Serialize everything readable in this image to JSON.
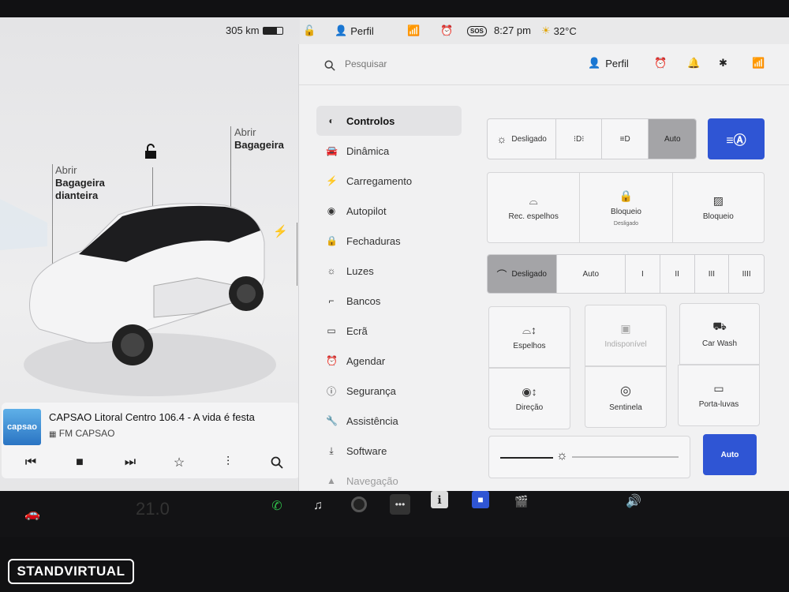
{
  "status": {
    "range": "305 km",
    "profile": "Perfil",
    "time": "8:27 pm",
    "temperature": "32°C",
    "sos": "SOS"
  },
  "car": {
    "front_trunk_action": "Abrir",
    "front_trunk_name_1": "Bagageira",
    "front_trunk_name_2": "dianteira",
    "rear_trunk_action": "Abrir",
    "rear_trunk_name": "Bagageira"
  },
  "media": {
    "art_text": "capsao",
    "title": "CAPSAO Litoral Centro 106.4 - A vida é festa",
    "source": "FM CAPSAO"
  },
  "search": {
    "placeholder": "Pesquisar"
  },
  "header": {
    "profile": "Perfil"
  },
  "menu": [
    {
      "label": "Controlos",
      "icon": "toggle-icon"
    },
    {
      "label": "Dinâmica",
      "icon": "car-icon"
    },
    {
      "label": "Carregamento",
      "icon": "bolt-icon"
    },
    {
      "label": "Autopilot",
      "icon": "steering-wheel-icon"
    },
    {
      "label": "Fechaduras",
      "icon": "lock-icon"
    },
    {
      "label": "Luzes",
      "icon": "sun-icon"
    },
    {
      "label": "Bancos",
      "icon": "seat-icon"
    },
    {
      "label": "Ecrã",
      "icon": "display-icon"
    },
    {
      "label": "Agendar",
      "icon": "alarm-icon"
    },
    {
      "label": "Segurança",
      "icon": "info-icon"
    },
    {
      "label": "Assistência",
      "icon": "wrench-icon"
    },
    {
      "label": "Software",
      "icon": "download-icon"
    },
    {
      "label": "Navegação",
      "icon": "navigation-icon"
    }
  ],
  "lights": {
    "off_label": "Desligado",
    "auto_label": "Auto",
    "selected": "Auto"
  },
  "mirror_row": {
    "fold_label": "Rec. espelhos",
    "lock_label": "Bloqueio",
    "lock_status": "Desligado",
    "window_lock_label": "Bloqueio"
  },
  "wipers": {
    "off_label": "Desligado",
    "auto_label": "Auto",
    "speeds": [
      "I",
      "II",
      "III",
      "IIII"
    ],
    "selected": "Desligado"
  },
  "adjust": {
    "mirrors": "Espelhos",
    "unavailable": "Indisponível",
    "car_wash": "Car Wash",
    "steering": "Direção",
    "sentry": "Sentinela",
    "glovebox": "Porta-luvas"
  },
  "brightness": {
    "auto_label": "Auto",
    "level": 0.35
  },
  "taskbar": {
    "cabin_temp": "21.0"
  },
  "watermark": "STANDVIRTUAL",
  "colors": {
    "accent": "#2f55d4",
    "selected": "#a4a4a7",
    "phone": "#2fbf4a"
  }
}
